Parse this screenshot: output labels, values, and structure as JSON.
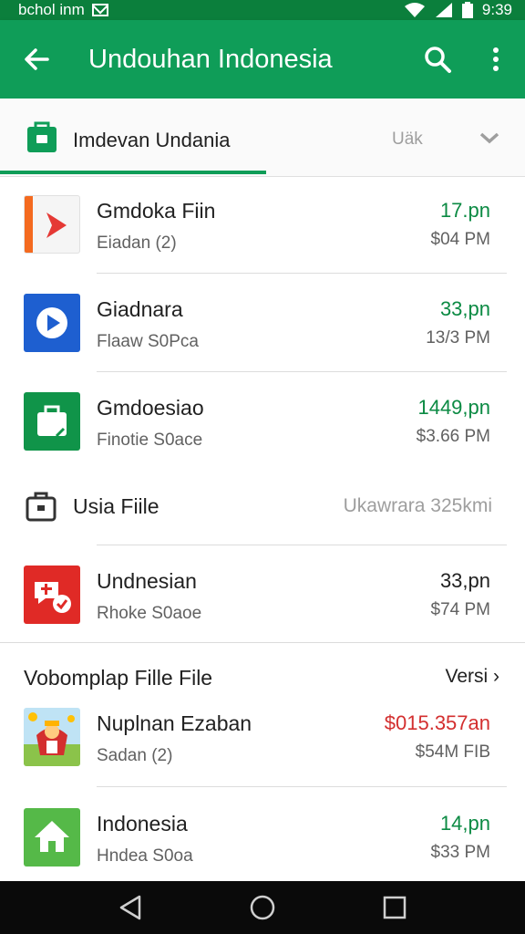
{
  "status_bar": {
    "carrier": "bchol inm",
    "time": "9:39"
  },
  "app_bar": {
    "title": "Undouhan Indonesia",
    "back_icon": "arrow-back-icon",
    "search_icon": "search-icon",
    "more_icon": "more-vert-icon"
  },
  "tab": {
    "label": "Imdevan Undania",
    "sort": "Uäk",
    "icon": "shopping-bag-icon"
  },
  "rows": [
    {
      "name": "Gmdoka Fiin",
      "sub": "Eiadan (2)",
      "value": "17.pn",
      "time": "$04 PM"
    },
    {
      "name": "Giadnara",
      "sub": "Flaaw S0Pca",
      "value": "33,pn",
      "time": "13/3 PM"
    },
    {
      "name": "Gmdoesiao",
      "sub": "Finotie S0ace",
      "value": "1449,pn",
      "time": "$3.66 PM"
    }
  ],
  "section": {
    "label": "Usia Fiile",
    "meta": "Ukawrara 325kmi"
  },
  "row4": {
    "name": "Undnesian",
    "sub": "Rhoke S0aoe",
    "value": "33,pn",
    "time": "$74 PM"
  },
  "section2": {
    "title": "Vobomplap Fille File",
    "link": "Versi ›"
  },
  "rows2": [
    {
      "name": "Nuplnan Ezaban",
      "sub": "Sadan (2)",
      "value": "$015.357an",
      "time": "$54M FIB"
    },
    {
      "name": "Indonesia",
      "sub": "Hndea S0oa",
      "value": "14,pn",
      "time": "$33 PM"
    }
  ],
  "nav": {
    "back": "triangle-back-icon",
    "home": "circle-home-icon",
    "recents": "square-recents-icon"
  },
  "colors": {
    "primary": "#0f9d58",
    "status": "#0b7f3c",
    "value_green": "#0b8a43",
    "value_red": "#d32f2f"
  }
}
